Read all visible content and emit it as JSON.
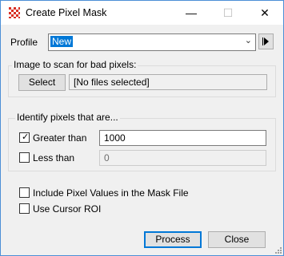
{
  "window": {
    "title": "Create Pixel Mask"
  },
  "titlebar": {
    "minimize": "—",
    "maximize": "☐",
    "close": "✕"
  },
  "profile": {
    "label": "Profile",
    "value": "New"
  },
  "scan_group": {
    "title": "Image to scan for bad pixels:",
    "select_label": "Select",
    "files_text": "[No files selected]"
  },
  "identify_group": {
    "title": "Identify pixels that are...",
    "greater_label": "Greater than",
    "greater_checked": true,
    "greater_value": "1000",
    "less_label": "Less than",
    "less_checked": false,
    "less_value": "0"
  },
  "options": {
    "include_label": "Include Pixel Values in the Mask File",
    "cursor_label": "Use Cursor ROI"
  },
  "actions": {
    "process_label": "Process",
    "close_label": "Close"
  },
  "colors": {
    "accent": "#0078d7",
    "window_border": "#4c8fd6",
    "icon_red": "#d93025"
  }
}
